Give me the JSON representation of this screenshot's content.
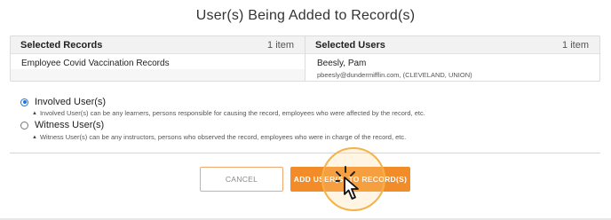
{
  "dialog": {
    "title": "User(s) Being Added to Record(s)"
  },
  "selected_records": {
    "heading": "Selected Records",
    "count": "1 item",
    "items": [
      {
        "name": "Employee Covid Vaccination Records"
      }
    ]
  },
  "selected_users": {
    "heading": "Selected Users",
    "count": "1 item",
    "items": [
      {
        "name": "Beesly, Pam",
        "detail": "pbeesly@dundermifflin.com, (CLEVELAND, UNION)"
      }
    ]
  },
  "options": [
    {
      "label": "Involved User(s)",
      "selected": true,
      "hint": "Involved User(s) can be any learners, persons responsible for causing the record, employees who were affected by the record, etc."
    },
    {
      "label": "Witness User(s)",
      "selected": false,
      "hint": "Witness User(s) can be any instructors, persons who observed the record, employees who were in charge of the record, etc."
    }
  ],
  "buttons": {
    "cancel": "CANCEL",
    "add": "ADD USER(S) TO RECORD(S)"
  },
  "colors": {
    "accent": "#f28c28",
    "radio_selected": "#1a73e8",
    "highlight_ring": "#f4b24a"
  },
  "icons": {
    "cursor": "pointer-hand-icon",
    "hint_caret": "caret-up-icon"
  }
}
